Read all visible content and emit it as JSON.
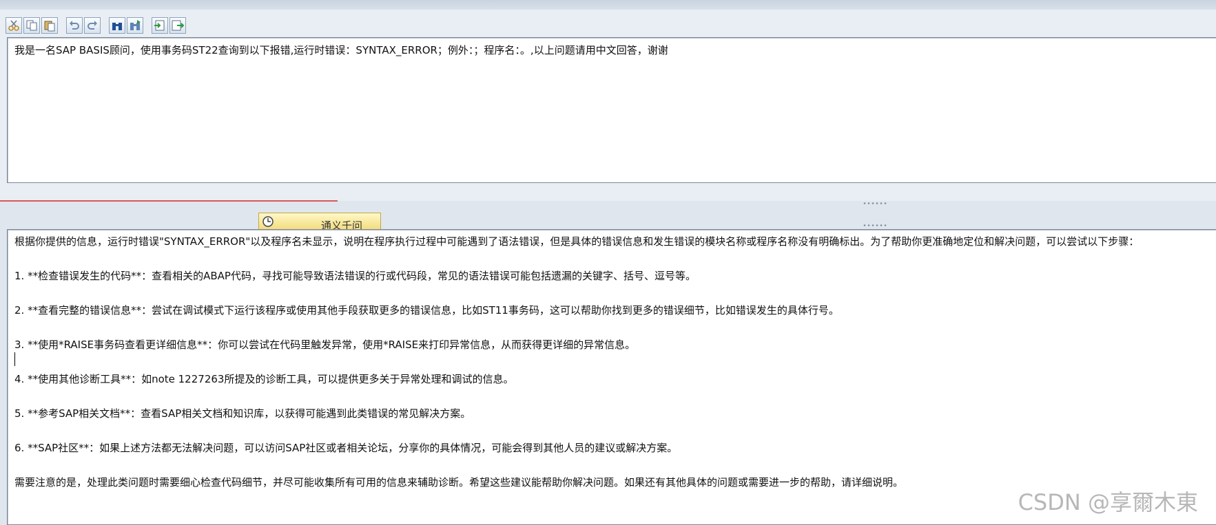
{
  "toolbar": {
    "buttons": [
      {
        "icon": "cut-icon"
      },
      {
        "icon": "copy-icon"
      },
      {
        "icon": "paste-icon"
      },
      {
        "icon": "undo-icon"
      },
      {
        "icon": "redo-icon"
      },
      {
        "icon": "find-icon"
      },
      {
        "icon": "find-next-icon"
      },
      {
        "icon": "import-icon"
      },
      {
        "icon": "export-icon"
      }
    ]
  },
  "input_editor": {
    "lines": [
      "我是一名SAP BASIS顾问，使用事务码ST22查询到以下报错,运行时错误：SYNTAX_ERROR；例外：；程序名：。,以上问题请用中文回答，谢谢"
    ]
  },
  "midbar": {
    "tab_label": "通义千问"
  },
  "output_editor": {
    "lines": [
      "根据你提供的信息，运行时错误\"SYNTAX_ERROR\"以及程序名未显示，说明在程序执行过程中可能遇到了语法错误，但是具体的错误信息和发生错误的模块名称或程序名称没有明确标出。为了帮助你更准确地定位和解决问题，可以尝试以下步骤：",
      "",
      "1. **检查错误发生的代码**：查看相关的ABAP代码，寻找可能导致语法错误的行或代码段，常见的语法错误可能包括遗漏的关键字、括号、逗号等。",
      "",
      "2. **查看完整的错误信息**：尝试在调试模式下运行该程序或使用其他手段获取更多的错误信息，比如ST11事务码，这可以帮助你找到更多的错误细节，比如错误发生的具体行号。",
      "",
      "3. **使用*RAISE事务码查看更详细信息**：你可以尝试在代码里触发异常，使用*RAISE来打印异常信息，从而获得更详细的异常信息。",
      "",
      "4. **使用其他诊断工具**：如note 1227263所提及的诊断工具，可以提供更多关于异常处理和调试的信息。",
      "",
      "5. **参考SAP相关文档**：查看SAP相关文档和知识库，以获得可能遇到此类错误的常见解决方案。",
      "",
      "6. **SAP社区**：如果上述方法都无法解决问题，可以访问SAP社区或者相关论坛，分享你的具体情况，可能会得到其他人员的建议或解决方案。",
      "",
      "需要注意的是，处理此类问题时需要细心检查代码细节，并尽可能收集所有可用的信息来辅助诊断。希望这些建议能帮助你解决问题。如果还有其他具体的问题或需要进一步的帮助，请详细说明。"
    ]
  },
  "watermark": "CSDN @享爾木東",
  "colors": {
    "background": "#dfe6ee",
    "editor_bg": "#ffffff",
    "accent_red": "#d95656",
    "tab_yellow": "#f3dd7f"
  }
}
